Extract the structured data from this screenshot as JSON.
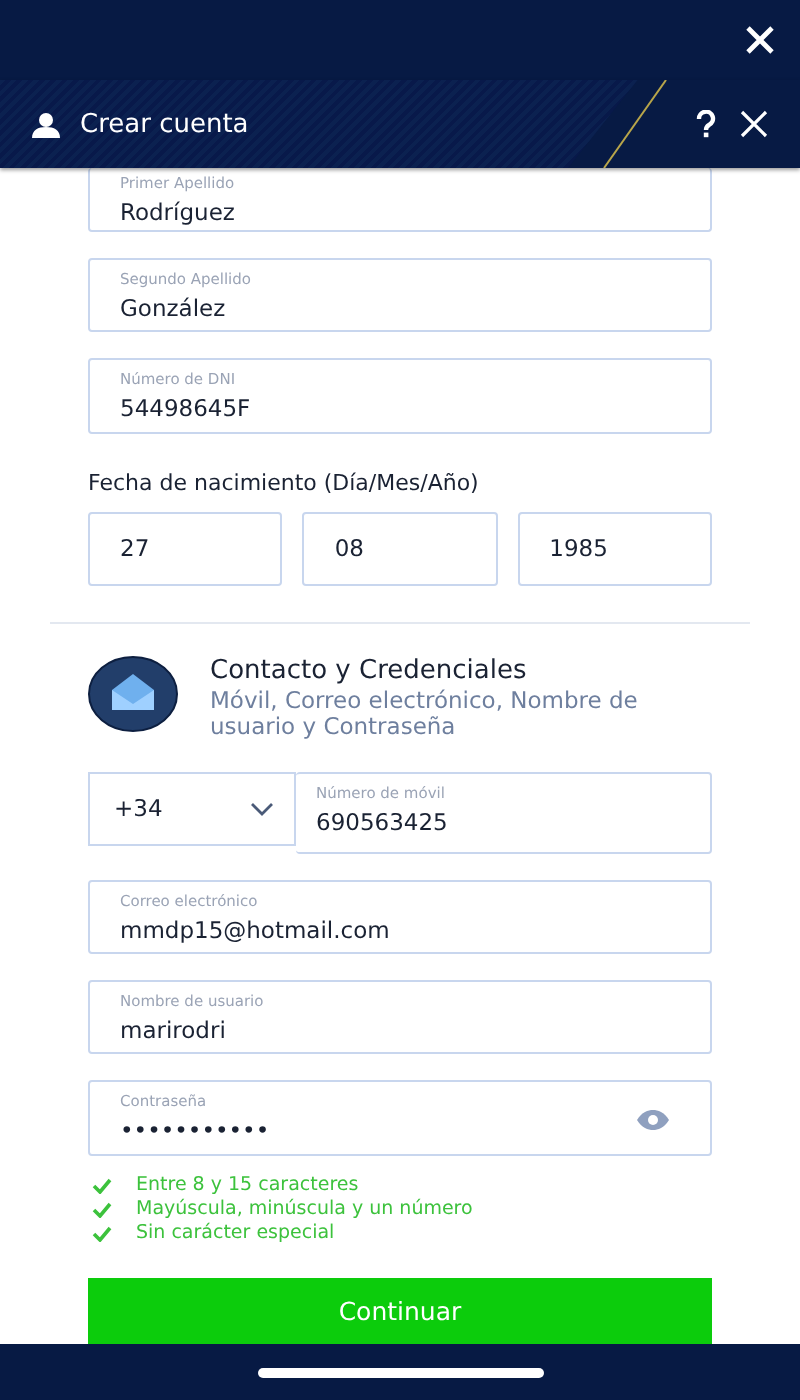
{
  "header": {
    "title": "Crear cuenta"
  },
  "name_fields": [
    {
      "label": "Primer Apellido",
      "value": "Rodríguez"
    },
    {
      "label": "Segundo Apellido",
      "value": "González"
    },
    {
      "label": "Número de DNI",
      "value": "54498645F"
    }
  ],
  "birth_date": {
    "label": "Fecha de nacimiento (Día/Mes/Año)",
    "parts": [
      "27",
      "08",
      "1985"
    ]
  },
  "section": {
    "title": "Contacto y Credenciales",
    "subtitle": "Móvil, Correo electrónico, Nombre de usuario y Contraseña"
  },
  "phone": {
    "country_code": "+34",
    "label": "Número de móvil",
    "value": "690563425"
  },
  "contact_fields": [
    {
      "label": "Correo electrónico",
      "value": "mmdp15@hotmail.com"
    },
    {
      "label": "Nombre de usuario",
      "value": "marirodri"
    }
  ],
  "password": {
    "label": "Contraseña",
    "value": "•••••••••••"
  },
  "rules": [
    {
      "text": "Entre 8 y 15 caracteres",
      "met": true
    },
    {
      "text": "Mayúscula, minúscula y un número",
      "met": true
    },
    {
      "text": "Sin carácter especial",
      "met": true
    }
  ],
  "continue_button": "Continuar"
}
